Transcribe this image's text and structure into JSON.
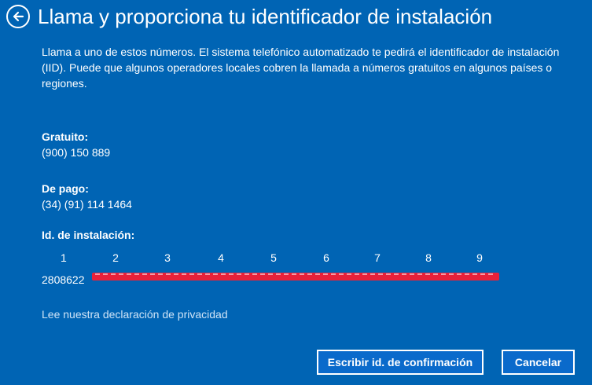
{
  "header": {
    "title": "Llama y proporciona tu identificador de instalación",
    "back_icon": "arrow-left-circle-icon"
  },
  "description": "Llama a uno de estos números. El sistema telefónico automatizado te pedirá el identificador de instalación (IID). Puede que algunos operadores locales cobren la llamada a números gratuitos en algunos países o regiones.",
  "toll_free": {
    "label": "Gratuito:",
    "number": "(900) 150 889"
  },
  "toll": {
    "label": "De pago:",
    "number": "(34) (91) 114 1464"
  },
  "installation_id": {
    "label": "Id. de instalación:",
    "columns": [
      "1",
      "2",
      "3",
      "4",
      "5",
      "6",
      "7",
      "8",
      "9"
    ],
    "first_group": "2808622"
  },
  "privacy_link": "Lee nuestra declaración de privacidad",
  "buttons": {
    "confirm": "Escribir id. de confirmación",
    "cancel": "Cancelar"
  },
  "colors": {
    "background": "#0064B4",
    "redaction": "#E8213A",
    "button_fill": "#0A6ACB"
  }
}
